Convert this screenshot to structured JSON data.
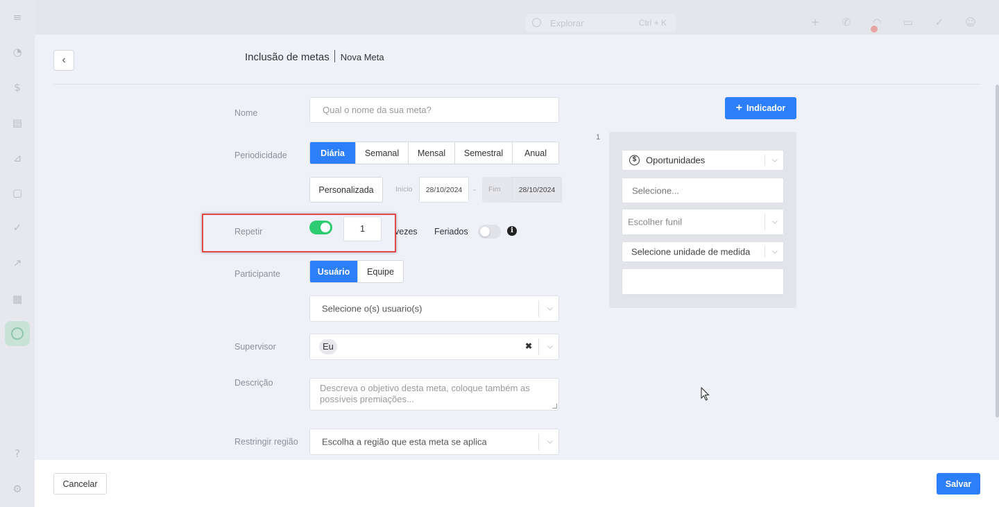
{
  "topbar": {
    "search_placeholder": "Explorar",
    "search_shortcut": "Ctrl + K"
  },
  "header": {
    "title": "Inclusão de metas",
    "subtitle": "Nova Meta"
  },
  "form": {
    "nome": {
      "label": "Nome",
      "placeholder": "Qual o nome da sua meta?"
    },
    "periodicidade": {
      "label": "Periodicidade",
      "options": [
        "Diária",
        "Semanal",
        "Mensal",
        "Semestral",
        "Anual"
      ],
      "selected": "Diária",
      "custom_button": "Personalizada",
      "inicio_label": "Inicio",
      "inicio_value": "28/10/2024",
      "range_sep": "-",
      "fim_label": "Fim",
      "fim_value": "28/10/2024"
    },
    "repetir": {
      "label": "Repetir",
      "toggle_on": true,
      "count": "1",
      "count_suffix": "vezes",
      "feriados_label": "Feriados",
      "feriados_on": false,
      "info_glyph": "i"
    },
    "participante": {
      "label": "Participante",
      "options": [
        "Usuário",
        "Equipe"
      ],
      "selected": "Usuário",
      "select_placeholder": "Selecione o(s) usuario(s)"
    },
    "supervisor": {
      "label": "Supervisor",
      "chip": "Eu",
      "clear": "✖"
    },
    "descricao": {
      "label": "Descrição",
      "placeholder": "Descreva o objetivo desta meta, coloque também as possíveis premiações..."
    },
    "regiao": {
      "label": "Restringir região",
      "placeholder": "Escolha a região que esta meta se aplica"
    }
  },
  "indicadores": {
    "add_button": "Indicador",
    "index": "1",
    "tipo": "Oportunidades",
    "tipo_icon": "$",
    "selecione": "Selecione...",
    "funil": "Escolher funil",
    "unidade": "Selecione unidade de medida",
    "valor": ""
  },
  "footer": {
    "cancel": "Cancelar",
    "save": "Salvar"
  },
  "icons": {
    "back": "‹",
    "chevron": "⌵",
    "plus": "+"
  },
  "colors": {
    "primary": "#2d7ff9",
    "toggle_on": "#2ecc71",
    "highlight": "#e24a4a"
  }
}
